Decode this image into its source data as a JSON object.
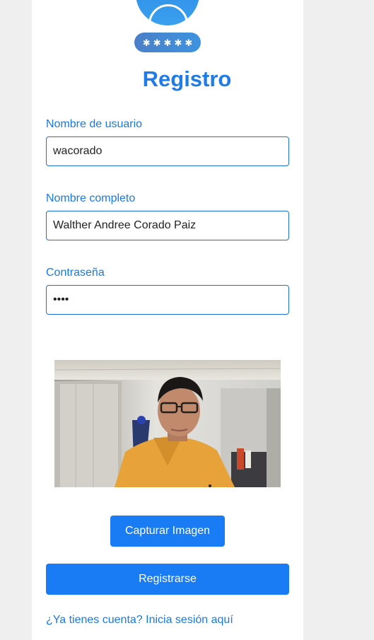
{
  "header": {
    "pin_dots": [
      "✱",
      "✱",
      "✱",
      "✱",
      "✱"
    ],
    "title": "Registro"
  },
  "form": {
    "username_label": "Nombre de usuario",
    "username_value": "wacorado",
    "fullname_label": "Nombre completo",
    "fullname_value": "Walther Andree Corado Paiz",
    "password_label": "Contraseña",
    "password_value": "1234"
  },
  "webcam": {
    "icon": "camera-feed"
  },
  "actions": {
    "capture_label": "Capturar Imagen",
    "register_label": "Registrarse",
    "login_link": "¿Ya tienes cuenta? Inicia sesión aquí"
  },
  "colors": {
    "accent": "#1a7cf5",
    "label": "#1a78e6",
    "background": "#efefef"
  }
}
